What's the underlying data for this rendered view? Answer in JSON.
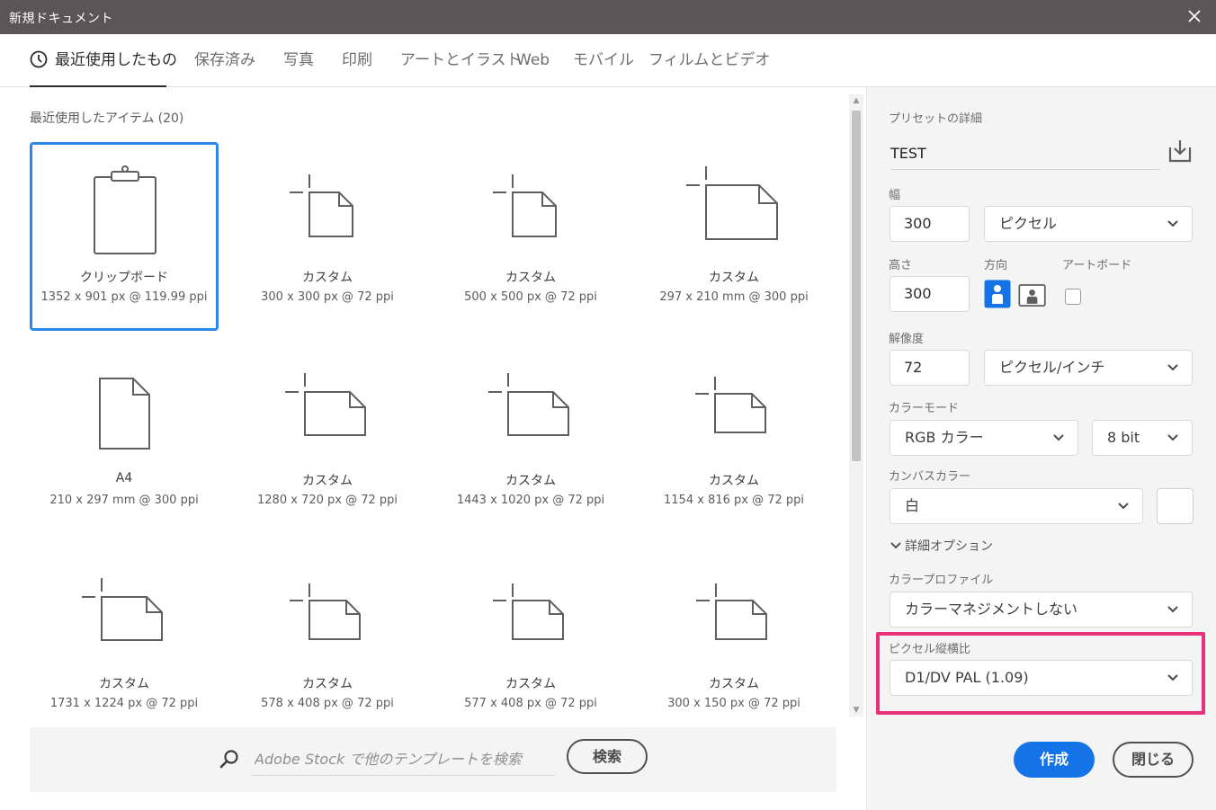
{
  "window": {
    "title": "新規ドキュメント",
    "close_icon": "close-icon"
  },
  "tabs": [
    {
      "label": "最近使用したもの",
      "active": true,
      "icon": "clock-icon"
    },
    {
      "label": "保存済み"
    },
    {
      "label": "写真"
    },
    {
      "label": "印刷"
    },
    {
      "label": "アートとイラスト"
    },
    {
      "label": "Web"
    },
    {
      "label": "モバイル"
    },
    {
      "label": "フィルムとビデオ"
    }
  ],
  "recent": {
    "header": "最近使用したアイテム",
    "count": "(20)",
    "items": [
      {
        "name": "クリップボード",
        "size": "1352 x 901 px @ 119.99 ppi",
        "icon": "clipboard-icon",
        "selected": true
      },
      {
        "name": "カスタム",
        "size": "300 x 300 px @ 72 ppi",
        "icon": "custom-document-icon"
      },
      {
        "name": "カスタム",
        "size": "500 x 500 px @ 72 ppi",
        "icon": "custom-document-icon"
      },
      {
        "name": "カスタム",
        "size": "297 x 210 mm @ 300 ppi",
        "icon": "custom-document-icon"
      },
      {
        "name": "A4",
        "size": "210 x 297 mm @ 300 ppi",
        "icon": "document-icon"
      },
      {
        "name": "カスタム",
        "size": "1280 x 720 px @ 72 ppi",
        "icon": "custom-document-icon"
      },
      {
        "name": "カスタム",
        "size": "1443 x 1020 px @ 72 ppi",
        "icon": "custom-document-icon"
      },
      {
        "name": "カスタム",
        "size": "1154 x 816 px @ 72 ppi",
        "icon": "custom-document-icon"
      },
      {
        "name": "カスタム",
        "size": "1731 x 1224 px @ 72 ppi",
        "icon": "custom-document-icon"
      },
      {
        "name": "カスタム",
        "size": "578 x 408 px @ 72 ppi",
        "icon": "custom-document-icon"
      },
      {
        "name": "カスタム",
        "size": "577 x 408 px @ 72 ppi",
        "icon": "custom-document-icon"
      },
      {
        "name": "カスタム",
        "size": "300 x 150 px @ 72 ppi",
        "icon": "custom-document-icon"
      }
    ]
  },
  "stock": {
    "placeholder": "Adobe Stock で他のテンプレートを検索",
    "button": "検索",
    "icon": "search-icon"
  },
  "preset": {
    "section_label": "プリセットの詳細",
    "name": "TEST",
    "save_icon": "save-preset-icon",
    "width_label": "幅",
    "width_value": "300",
    "width_unit": "ピクセル",
    "height_label": "高さ",
    "height_value": "300",
    "orientation_label": "方向",
    "orientation_selected": "portrait",
    "artboard_label": "アートボード",
    "artboard_checked": false,
    "resolution_label": "解像度",
    "resolution_value": "72",
    "resolution_unit": "ピクセル/インチ",
    "color_mode_label": "カラーモード",
    "color_mode": "RGB カラー",
    "bit_depth": "8 bit",
    "canvas_color_label": "カンバスカラー",
    "canvas_color": "白",
    "canvas_swatch_color": "#ffffff",
    "advanced_label": "詳細オプション",
    "color_profile_label": "カラープロファイル",
    "color_profile": "カラーマネジメントしない",
    "pixel_aspect_label": "ピクセル縦横比",
    "pixel_aspect": "D1/DV PAL (1.09)",
    "highlight_color": "#e8317a"
  },
  "actions": {
    "create": "作成",
    "close": "閉じる",
    "create_color": "#1473e6"
  }
}
